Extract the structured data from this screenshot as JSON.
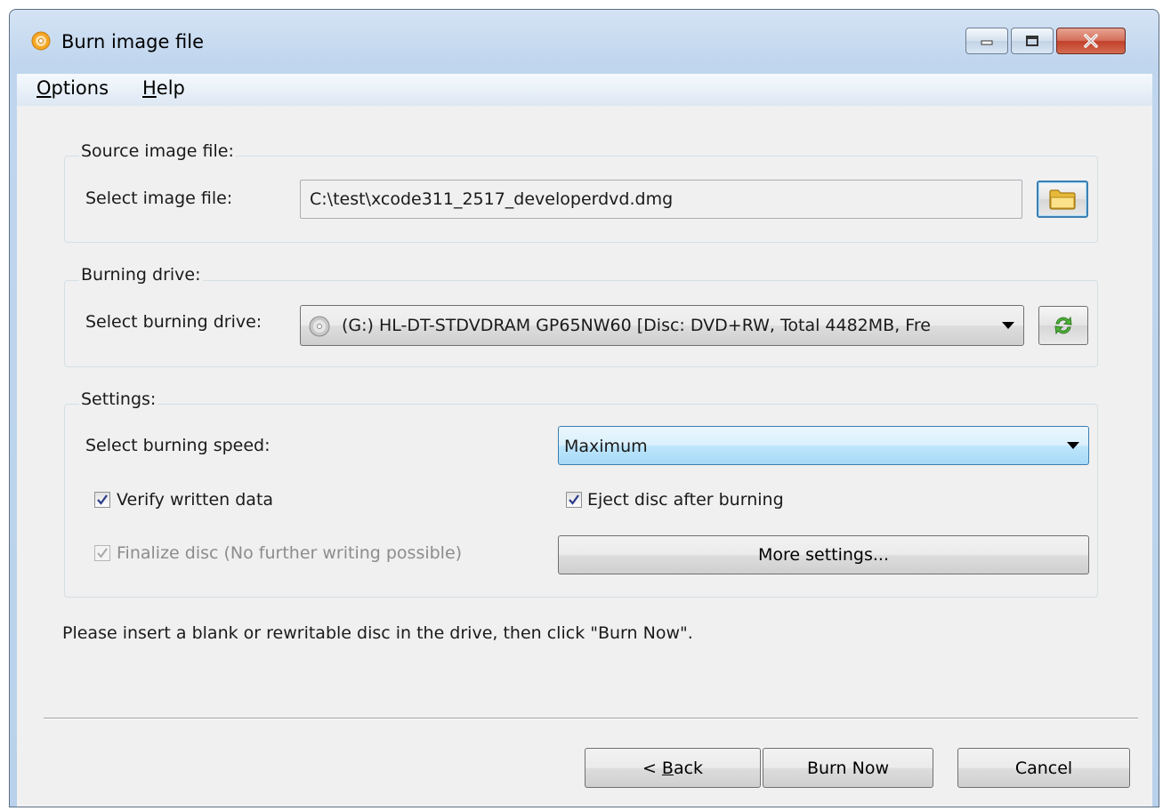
{
  "window": {
    "title": "Burn image file",
    "buttons": {
      "minimize": "minimize",
      "maximize": "maximize",
      "close": "close"
    }
  },
  "menu": {
    "options": {
      "first": "O",
      "rest": "ptions"
    },
    "help": {
      "first": "H",
      "rest": "elp"
    }
  },
  "source": {
    "group_label": "Source image file:",
    "field_label": "Select image file:",
    "path_value": "C:\\test\\xcode311_2517_developerdvd.dmg",
    "browse_icon": "folder-icon"
  },
  "drive": {
    "group_label": "Burning drive:",
    "field_label": "Select burning drive:",
    "selected": "(G:) HL-DT-STDVDRAM GP65NW60 [Disc: DVD+RW, Total 4482MB, Fre",
    "refresh_icon": "refresh-icon"
  },
  "settings": {
    "group_label": "Settings:",
    "speed_label": "Select burning speed:",
    "speed_value": "Maximum",
    "verify_label": "Verify written data",
    "verify_checked": true,
    "eject_label": "Eject disc after burning",
    "eject_checked": true,
    "finalize_label": "Finalize disc (No further writing possible)",
    "finalize_checked": true,
    "finalize_disabled": true,
    "more_settings_label": "More settings..."
  },
  "status_message": "Please insert a blank or rewritable disc in the drive, then click \"Burn Now\".",
  "footer": {
    "back": {
      "prefix": "< ",
      "underlined": "B",
      "rest": "ack"
    },
    "burn_now": "Burn Now",
    "cancel": "Cancel"
  },
  "colors": {
    "accent": "#3c7fb1",
    "client_bg": "#f0f0f0",
    "close_red": "#c2402b"
  }
}
